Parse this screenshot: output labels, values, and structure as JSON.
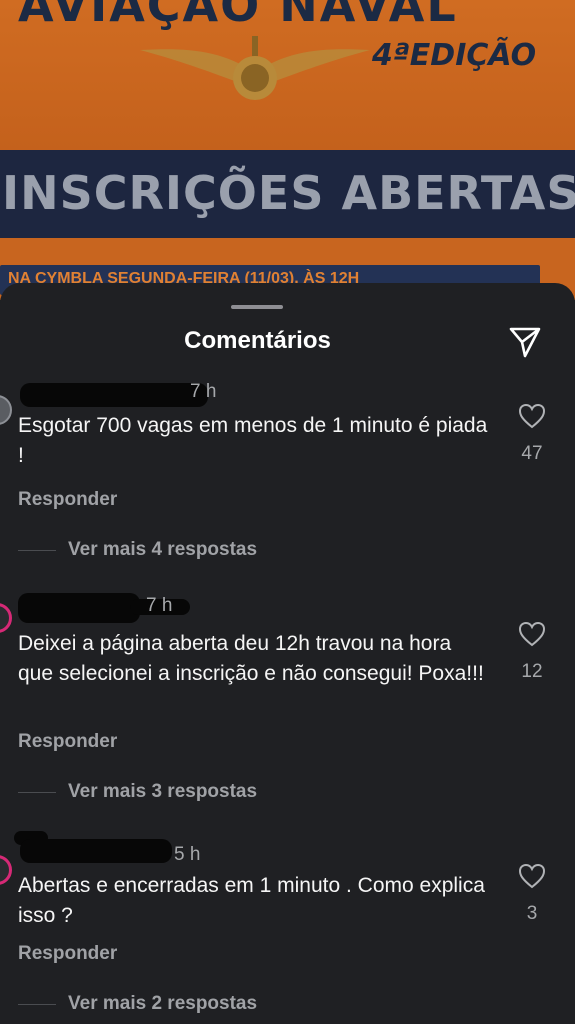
{
  "post": {
    "title_top": "AVIAÇÃO NAVAL",
    "edition": "4ªEDIÇÃO",
    "subtitle": "INSCRIÇÕES ABERTAS",
    "strip_text": "NA CYMBLA   SEGUNDA-FEIRA (11/03), ÀS 12H"
  },
  "sheet": {
    "title": "Comentários",
    "send_icon": "send-icon"
  },
  "comments": [
    {
      "time": "7 h",
      "text": "Esgotar 700 vagas em menos de 1 minuto é piada !",
      "likes": "47",
      "reply_label": "Responder",
      "more_replies": "Ver mais 4 respostas"
    },
    {
      "time": "7 h",
      "text": "Deixei a página aberta deu 12h  travou na hora que selecionei a inscrição e não consegui! Poxa!!!",
      "likes": "12",
      "reply_label": "Responder",
      "more_replies": "Ver mais 3 respostas"
    },
    {
      "time": "5 h",
      "text": "Abertas e encerradas em 1 minuto . Como explica isso ?",
      "likes": "3",
      "reply_label": "Responder",
      "more_replies": "Ver mais 2 respostas"
    }
  ],
  "colors": {
    "sheet_bg": "#1f2023",
    "post_orange": "#c8651f",
    "post_navy": "#1d2640",
    "avatar_ring": "#d62976"
  }
}
